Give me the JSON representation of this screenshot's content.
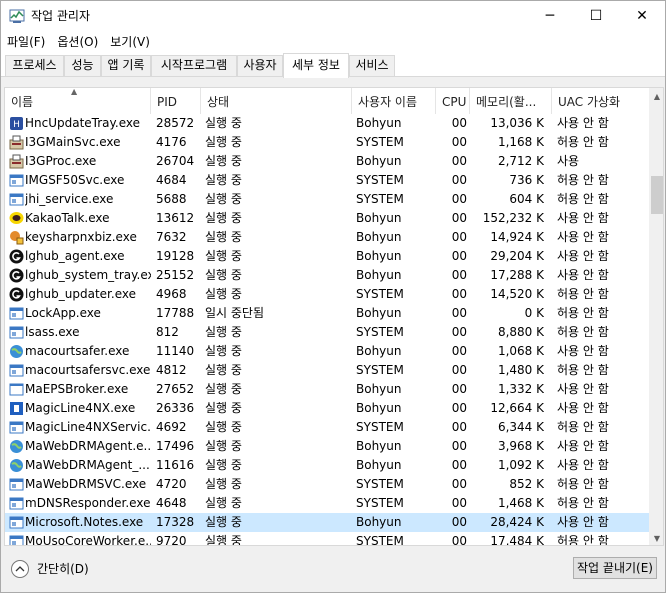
{
  "window": {
    "title": "작업 관리자"
  },
  "window_controls": {
    "minimize": "─",
    "maximize": "☐",
    "close": "✕"
  },
  "menu": [
    "파일(F)",
    "옵션(O)",
    "보기(V)"
  ],
  "tabs": [
    {
      "label": "프로세스",
      "active": false
    },
    {
      "label": "성능",
      "active": false
    },
    {
      "label": "앱 기록",
      "active": false
    },
    {
      "label": "시작프로그램",
      "active": false
    },
    {
      "label": "사용자",
      "active": false
    },
    {
      "label": "세부 정보",
      "active": true
    },
    {
      "label": "서비스",
      "active": false
    }
  ],
  "columns": [
    "이름",
    "PID",
    "상태",
    "사용자 이름",
    "CPU",
    "메모리(활...",
    "UAC 가상화"
  ],
  "sort_arrow": "▲",
  "rows": [
    {
      "icon": "hnc-icon",
      "name": "HncUpdateTray.exe",
      "pid": "28572",
      "status": "실행 중",
      "user": "Bohyun",
      "cpu": "00",
      "memory": "13,036 K",
      "uac": "사용 안 함",
      "selected": false
    },
    {
      "icon": "installer-icon",
      "name": "I3GMainSvc.exe",
      "pid": "4176",
      "status": "실행 중",
      "user": "SYSTEM",
      "cpu": "00",
      "memory": "1,168 K",
      "uac": "허용 안 함",
      "selected": false
    },
    {
      "icon": "installer-icon",
      "name": "I3GProc.exe",
      "pid": "26704",
      "status": "실행 중",
      "user": "Bohyun",
      "cpu": "00",
      "memory": "2,712 K",
      "uac": "사용",
      "selected": false
    },
    {
      "icon": "app-window-icon",
      "name": "IMGSF50Svc.exe",
      "pid": "4684",
      "status": "실행 중",
      "user": "SYSTEM",
      "cpu": "00",
      "memory": "736 K",
      "uac": "허용 안 함",
      "selected": false
    },
    {
      "icon": "app-window-icon",
      "name": "jhi_service.exe",
      "pid": "5688",
      "status": "실행 중",
      "user": "SYSTEM",
      "cpu": "00",
      "memory": "604 K",
      "uac": "허용 안 함",
      "selected": false
    },
    {
      "icon": "kakaotalk-icon",
      "name": "KakaoTalk.exe",
      "pid": "13612",
      "status": "실행 중",
      "user": "Bohyun",
      "cpu": "00",
      "memory": "152,232 K",
      "uac": "사용 안 함",
      "selected": false
    },
    {
      "icon": "keysharp-icon",
      "name": "keysharpnxbiz.exe",
      "pid": "7632",
      "status": "실행 중",
      "user": "Bohyun",
      "cpu": "00",
      "memory": "14,924 K",
      "uac": "사용 안 함",
      "selected": false
    },
    {
      "icon": "logitech-g-icon",
      "name": "lghub_agent.exe",
      "pid": "19128",
      "status": "실행 중",
      "user": "Bohyun",
      "cpu": "00",
      "memory": "29,204 K",
      "uac": "사용 안 함",
      "selected": false
    },
    {
      "icon": "logitech-g-icon",
      "name": "lghub_system_tray.exe",
      "pid": "25152",
      "status": "실행 중",
      "user": "Bohyun",
      "cpu": "00",
      "memory": "17,288 K",
      "uac": "사용 안 함",
      "selected": false
    },
    {
      "icon": "logitech-g-icon",
      "name": "lghub_updater.exe",
      "pid": "4968",
      "status": "실행 중",
      "user": "SYSTEM",
      "cpu": "00",
      "memory": "14,520 K",
      "uac": "허용 안 함",
      "selected": false
    },
    {
      "icon": "app-window-icon",
      "name": "LockApp.exe",
      "pid": "17788",
      "status": "일시 중단됨",
      "user": "Bohyun",
      "cpu": "00",
      "memory": "0 K",
      "uac": "허용 안 함",
      "selected": false
    },
    {
      "icon": "app-window-icon",
      "name": "lsass.exe",
      "pid": "812",
      "status": "실행 중",
      "user": "SYSTEM",
      "cpu": "00",
      "memory": "8,880 K",
      "uac": "허용 안 함",
      "selected": false
    },
    {
      "icon": "globe-icon",
      "name": "macourtsafer.exe",
      "pid": "11140",
      "status": "실행 중",
      "user": "Bohyun",
      "cpu": "00",
      "memory": "1,068 K",
      "uac": "사용 안 함",
      "selected": false
    },
    {
      "icon": "app-window-icon",
      "name": "macourtsafersvc.exe",
      "pid": "4812",
      "status": "실행 중",
      "user": "SYSTEM",
      "cpu": "00",
      "memory": "1,480 K",
      "uac": "허용 안 함",
      "selected": false
    },
    {
      "icon": "blank-window-icon",
      "name": "MaEPSBroker.exe",
      "pid": "27652",
      "status": "실행 중",
      "user": "Bohyun",
      "cpu": "00",
      "memory": "1,332 K",
      "uac": "사용 안 함",
      "selected": false
    },
    {
      "icon": "magicline-icon",
      "name": "MagicLine4NX.exe",
      "pid": "26336",
      "status": "실행 중",
      "user": "Bohyun",
      "cpu": "00",
      "memory": "12,664 K",
      "uac": "사용 안 함",
      "selected": false
    },
    {
      "icon": "app-window-icon",
      "name": "MagicLine4NXServic...",
      "pid": "4692",
      "status": "실행 중",
      "user": "SYSTEM",
      "cpu": "00",
      "memory": "6,344 K",
      "uac": "허용 안 함",
      "selected": false
    },
    {
      "icon": "globe-icon",
      "name": "MaWebDRMAgent.e...",
      "pid": "17496",
      "status": "실행 중",
      "user": "Bohyun",
      "cpu": "00",
      "memory": "3,968 K",
      "uac": "사용 안 함",
      "selected": false
    },
    {
      "icon": "globe-icon",
      "name": "MaWebDRMAgent_...",
      "pid": "11616",
      "status": "실행 중",
      "user": "Bohyun",
      "cpu": "00",
      "memory": "1,092 K",
      "uac": "사용 안 함",
      "selected": false
    },
    {
      "icon": "app-window-icon",
      "name": "MaWebDRMSVC.exe",
      "pid": "4720",
      "status": "실행 중",
      "user": "SYSTEM",
      "cpu": "00",
      "memory": "852 K",
      "uac": "허용 안 함",
      "selected": false
    },
    {
      "icon": "app-window-icon",
      "name": "mDNSResponder.exe",
      "pid": "4648",
      "status": "실행 중",
      "user": "SYSTEM",
      "cpu": "00",
      "memory": "1,468 K",
      "uac": "허용 안 함",
      "selected": false
    },
    {
      "icon": "app-window-icon",
      "name": "Microsoft.Notes.exe",
      "pid": "17328",
      "status": "실행 중",
      "user": "Bohyun",
      "cpu": "00",
      "memory": "28,424 K",
      "uac": "사용 안 함",
      "selected": true
    },
    {
      "icon": "app-window-icon",
      "name": "MoUsoCoreWorker.e...",
      "pid": "9720",
      "status": "실행 중",
      "user": "SYSTEM",
      "cpu": "00",
      "memory": "17,484 K",
      "uac": "허용 안 함",
      "selected": false
    }
  ],
  "footer": {
    "collapse_label": "간단히(D)",
    "end_task_label": "작업 끝내기(E)"
  },
  "colors": {
    "selected_row": "#cce8ff",
    "window_bg": "#f0f0f0",
    "list_bg": "#ffffff"
  }
}
